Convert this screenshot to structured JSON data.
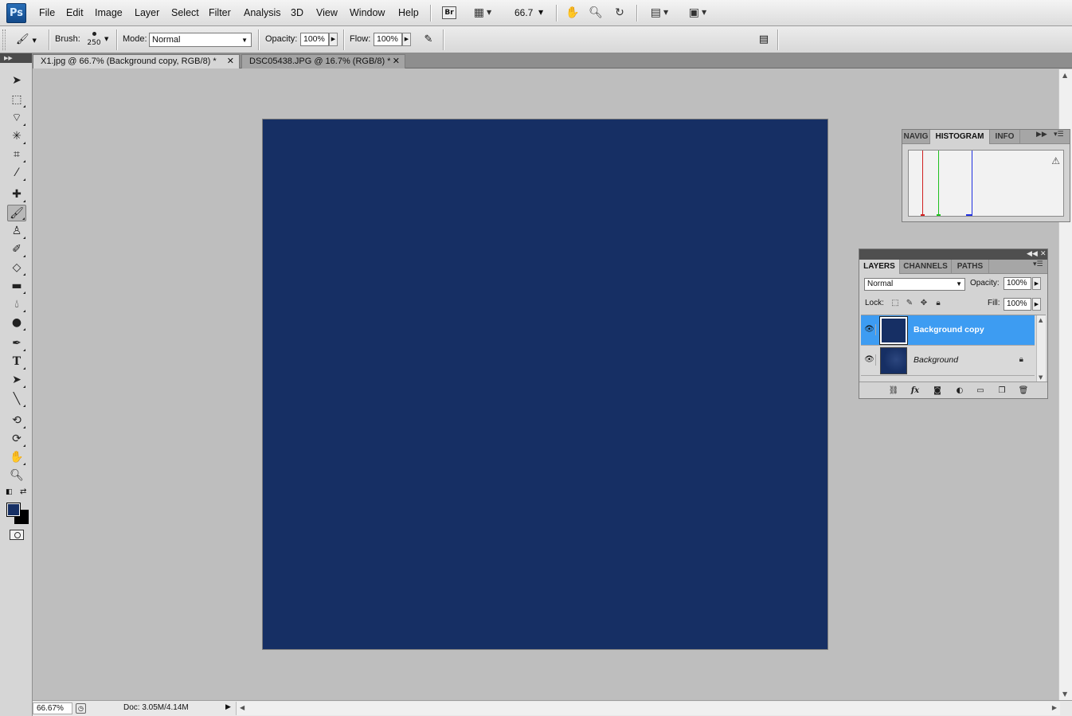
{
  "app": {
    "logo": "Ps"
  },
  "menu": [
    "File",
    "Edit",
    "Image",
    "Layer",
    "Select",
    "Filter",
    "Analysis",
    "3D",
    "View",
    "Window",
    "Help"
  ],
  "menubar": {
    "bridge_label": "Br",
    "zoom": "66.7"
  },
  "options": {
    "brush_label": "Brush:",
    "brush_size": "250",
    "mode_label": "Mode:",
    "mode_value": "Normal",
    "opacity_label": "Opacity:",
    "opacity_value": "100%",
    "flow_label": "Flow:",
    "flow_value": "100%"
  },
  "tabs": [
    {
      "label": "X1.jpg @ 66.7% (Background copy, RGB/8) *",
      "active": true
    },
    {
      "label": "DSC05438.JPG @ 16.7% (RGB/8) *",
      "active": false
    }
  ],
  "colors": {
    "canvas": "#162f64",
    "foreground": "#162f64",
    "background": "#000000",
    "selection": "#3d9cf2",
    "histogram_red": "#d02020",
    "histogram_green": "#20c020",
    "histogram_blue": "#2030e0"
  },
  "status": {
    "zoom": "66.67%",
    "doc": "Doc: 3.05M/4.14M"
  },
  "histogram_panel": {
    "tabs": [
      "NAVIG",
      "HISTOGRAM",
      "INFO"
    ],
    "active_tab": "HISTOGRAM"
  },
  "layers_panel": {
    "tabs": [
      "LAYERS",
      "CHANNELS",
      "PATHS"
    ],
    "active_tab": "LAYERS",
    "blend_mode": "Normal",
    "opacity_label": "Opacity:",
    "opacity_value": "100%",
    "lock_label": "Lock:",
    "fill_label": "Fill:",
    "fill_value": "100%",
    "layers": [
      {
        "name": "Background copy",
        "selected": true,
        "locked": false
      },
      {
        "name": "Background",
        "selected": false,
        "locked": true
      }
    ]
  },
  "icons": {
    "tools": [
      "move-icon",
      "marquee-icon",
      "lasso-icon",
      "magic-wand-icon",
      "crop-icon",
      "eyedropper-icon",
      "healing-brush-icon",
      "brush-icon",
      "clone-stamp-icon",
      "history-brush-icon",
      "eraser-icon",
      "gradient-icon",
      "blur-icon",
      "dodge-icon",
      "pen-icon",
      "type-icon",
      "path-selection-icon",
      "line-icon",
      "3d-rotate-icon",
      "3d-orbit-icon",
      "hand-icon",
      "zoom-icon"
    ]
  }
}
